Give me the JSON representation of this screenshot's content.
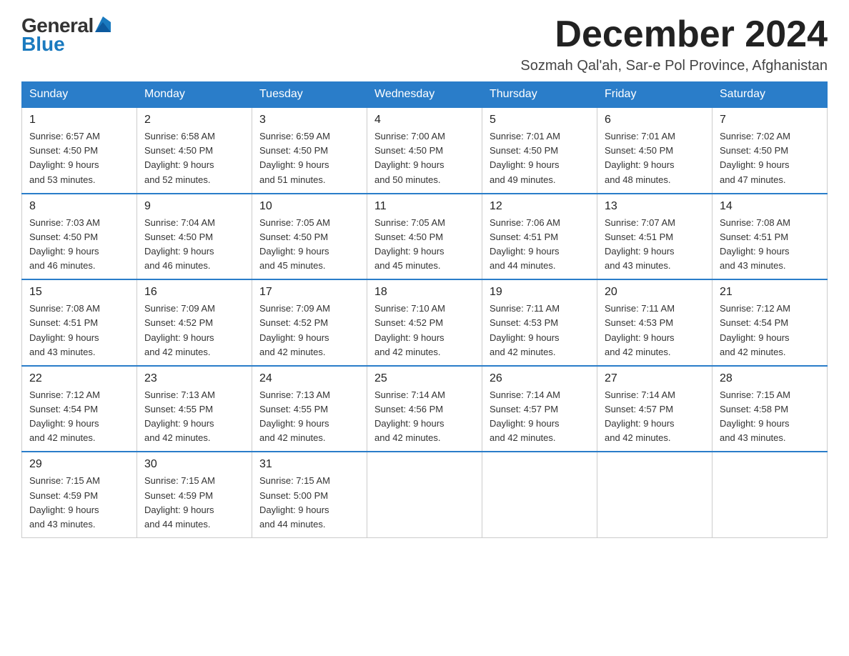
{
  "header": {
    "logo_general": "General",
    "logo_blue": "Blue",
    "month_title": "December 2024",
    "subtitle": "Sozmah Qal'ah, Sar-e Pol Province, Afghanistan"
  },
  "days_of_week": [
    "Sunday",
    "Monday",
    "Tuesday",
    "Wednesday",
    "Thursday",
    "Friday",
    "Saturday"
  ],
  "weeks": [
    [
      {
        "day": "1",
        "sunrise": "6:57 AM",
        "sunset": "4:50 PM",
        "daylight": "9 hours and 53 minutes."
      },
      {
        "day": "2",
        "sunrise": "6:58 AM",
        "sunset": "4:50 PM",
        "daylight": "9 hours and 52 minutes."
      },
      {
        "day": "3",
        "sunrise": "6:59 AM",
        "sunset": "4:50 PM",
        "daylight": "9 hours and 51 minutes."
      },
      {
        "day": "4",
        "sunrise": "7:00 AM",
        "sunset": "4:50 PM",
        "daylight": "9 hours and 50 minutes."
      },
      {
        "day": "5",
        "sunrise": "7:01 AM",
        "sunset": "4:50 PM",
        "daylight": "9 hours and 49 minutes."
      },
      {
        "day": "6",
        "sunrise": "7:01 AM",
        "sunset": "4:50 PM",
        "daylight": "9 hours and 48 minutes."
      },
      {
        "day": "7",
        "sunrise": "7:02 AM",
        "sunset": "4:50 PM",
        "daylight": "9 hours and 47 minutes."
      }
    ],
    [
      {
        "day": "8",
        "sunrise": "7:03 AM",
        "sunset": "4:50 PM",
        "daylight": "9 hours and 46 minutes."
      },
      {
        "day": "9",
        "sunrise": "7:04 AM",
        "sunset": "4:50 PM",
        "daylight": "9 hours and 46 minutes."
      },
      {
        "day": "10",
        "sunrise": "7:05 AM",
        "sunset": "4:50 PM",
        "daylight": "9 hours and 45 minutes."
      },
      {
        "day": "11",
        "sunrise": "7:05 AM",
        "sunset": "4:50 PM",
        "daylight": "9 hours and 45 minutes."
      },
      {
        "day": "12",
        "sunrise": "7:06 AM",
        "sunset": "4:51 PM",
        "daylight": "9 hours and 44 minutes."
      },
      {
        "day": "13",
        "sunrise": "7:07 AM",
        "sunset": "4:51 PM",
        "daylight": "9 hours and 43 minutes."
      },
      {
        "day": "14",
        "sunrise": "7:08 AM",
        "sunset": "4:51 PM",
        "daylight": "9 hours and 43 minutes."
      }
    ],
    [
      {
        "day": "15",
        "sunrise": "7:08 AM",
        "sunset": "4:51 PM",
        "daylight": "9 hours and 43 minutes."
      },
      {
        "day": "16",
        "sunrise": "7:09 AM",
        "sunset": "4:52 PM",
        "daylight": "9 hours and 42 minutes."
      },
      {
        "day": "17",
        "sunrise": "7:09 AM",
        "sunset": "4:52 PM",
        "daylight": "9 hours and 42 minutes."
      },
      {
        "day": "18",
        "sunrise": "7:10 AM",
        "sunset": "4:52 PM",
        "daylight": "9 hours and 42 minutes."
      },
      {
        "day": "19",
        "sunrise": "7:11 AM",
        "sunset": "4:53 PM",
        "daylight": "9 hours and 42 minutes."
      },
      {
        "day": "20",
        "sunrise": "7:11 AM",
        "sunset": "4:53 PM",
        "daylight": "9 hours and 42 minutes."
      },
      {
        "day": "21",
        "sunrise": "7:12 AM",
        "sunset": "4:54 PM",
        "daylight": "9 hours and 42 minutes."
      }
    ],
    [
      {
        "day": "22",
        "sunrise": "7:12 AM",
        "sunset": "4:54 PM",
        "daylight": "9 hours and 42 minutes."
      },
      {
        "day": "23",
        "sunrise": "7:13 AM",
        "sunset": "4:55 PM",
        "daylight": "9 hours and 42 minutes."
      },
      {
        "day": "24",
        "sunrise": "7:13 AM",
        "sunset": "4:55 PM",
        "daylight": "9 hours and 42 minutes."
      },
      {
        "day": "25",
        "sunrise": "7:14 AM",
        "sunset": "4:56 PM",
        "daylight": "9 hours and 42 minutes."
      },
      {
        "day": "26",
        "sunrise": "7:14 AM",
        "sunset": "4:57 PM",
        "daylight": "9 hours and 42 minutes."
      },
      {
        "day": "27",
        "sunrise": "7:14 AM",
        "sunset": "4:57 PM",
        "daylight": "9 hours and 42 minutes."
      },
      {
        "day": "28",
        "sunrise": "7:15 AM",
        "sunset": "4:58 PM",
        "daylight": "9 hours and 43 minutes."
      }
    ],
    [
      {
        "day": "29",
        "sunrise": "7:15 AM",
        "sunset": "4:59 PM",
        "daylight": "9 hours and 43 minutes."
      },
      {
        "day": "30",
        "sunrise": "7:15 AM",
        "sunset": "4:59 PM",
        "daylight": "9 hours and 44 minutes."
      },
      {
        "day": "31",
        "sunrise": "7:15 AM",
        "sunset": "5:00 PM",
        "daylight": "9 hours and 44 minutes."
      },
      null,
      null,
      null,
      null
    ]
  ],
  "cell_labels": {
    "sunrise": "Sunrise: ",
    "sunset": "Sunset: ",
    "daylight": "Daylight: "
  }
}
